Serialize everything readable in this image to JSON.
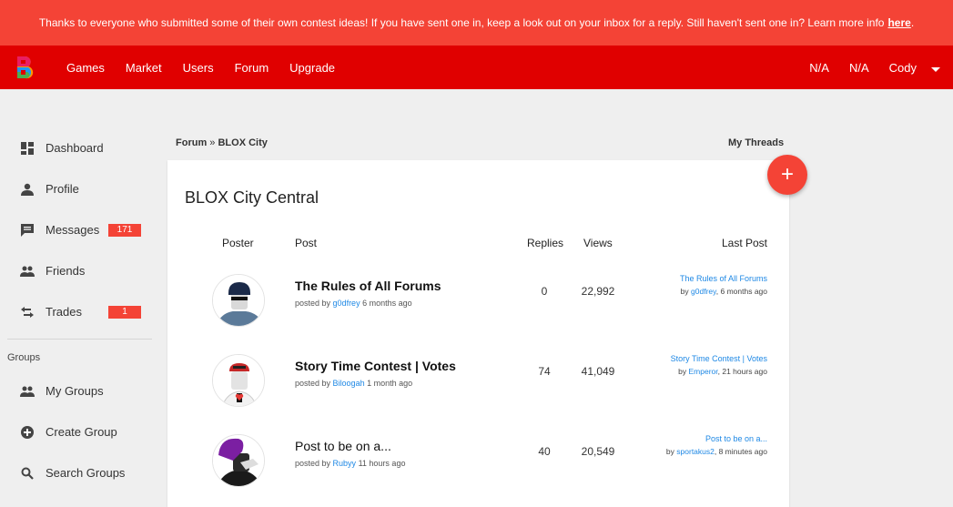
{
  "banner": {
    "text": "Thanks to everyone who submitted some of their own contest ideas! If you have sent one in, keep a look out on your inbox for a reply. Still haven't sent one in? Learn more info",
    "link_label": "here",
    "trailing": "."
  },
  "navbar": {
    "links": [
      "Games",
      "Market",
      "Users",
      "Forum",
      "Upgrade"
    ],
    "right": [
      "N/A",
      "N/A",
      "Cody"
    ]
  },
  "sidebar": {
    "items": [
      {
        "label": "Dashboard",
        "icon": "dashboard-icon"
      },
      {
        "label": "Profile",
        "icon": "person-icon"
      },
      {
        "label": "Messages",
        "icon": "message-icon",
        "badge": "171"
      },
      {
        "label": "Friends",
        "icon": "people-icon"
      },
      {
        "label": "Trades",
        "icon": "swap-icon",
        "badge": "1"
      }
    ],
    "groups_heading": "Groups",
    "group_items": [
      {
        "label": "My Groups",
        "icon": "people-icon"
      },
      {
        "label": "Create Group",
        "icon": "add-circle-icon"
      },
      {
        "label": "Search Groups",
        "icon": "search-icon"
      }
    ]
  },
  "breadcrumb": {
    "root": "Forum",
    "separator": "»",
    "current": "BLOX City"
  },
  "my_threads": "My Threads",
  "fab_label": "+",
  "forum": {
    "title": "BLOX City Central",
    "columns": {
      "poster": "Poster",
      "post": "Post",
      "replies": "Replies",
      "views": "Views",
      "last_post": "Last Post"
    },
    "threads": [
      {
        "title": "The Rules of All Forums",
        "bold": true,
        "posted_by_prefix": "posted by",
        "author": "g0dfrey",
        "age": "6 months ago",
        "replies": "0",
        "views": "22,992",
        "last_title": "The Rules of All Forums",
        "last_by_prefix": "by",
        "last_author": "g0dfrey",
        "last_age": ", 6 months ago"
      },
      {
        "title": "Story Time Contest | Votes",
        "bold": true,
        "posted_by_prefix": "posted by",
        "author": "Biloogah",
        "age": "1 month ago",
        "replies": "74",
        "views": "41,049",
        "last_title": "Story Time Contest | Votes",
        "last_by_prefix": "by",
        "last_author": "Emperor",
        "last_age": ", 21 hours ago"
      },
      {
        "title": "Post to be on a...",
        "bold": false,
        "posted_by_prefix": "posted by",
        "author": "Rubyy",
        "age": "11 hours ago",
        "replies": "40",
        "views": "20,549",
        "last_title": "Post to be on a...",
        "last_by_prefix": "by",
        "last_author": "sportakus2",
        "last_age": ", 8 minutes ago"
      }
    ]
  },
  "colors": {
    "banner": "#f44336",
    "navbar": "#e00000",
    "accent": "#f44336",
    "link": "#1e88e5"
  }
}
